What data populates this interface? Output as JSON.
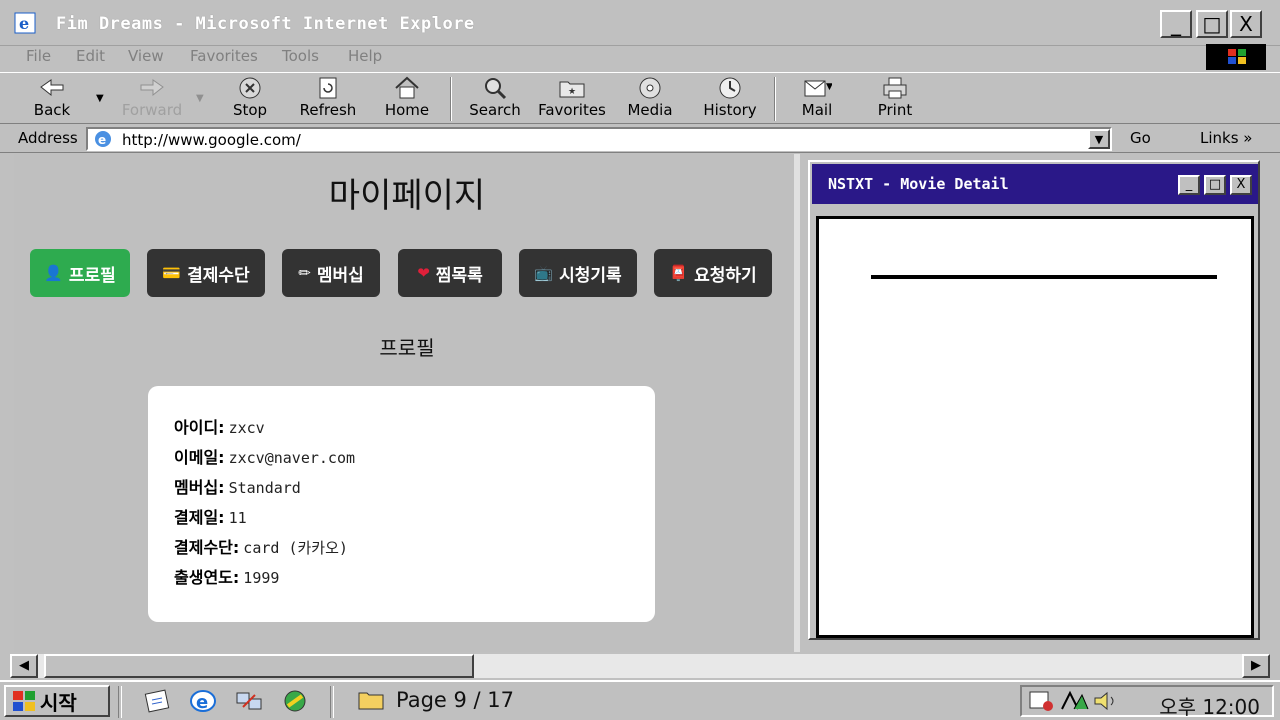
{
  "window": {
    "title": "Fim Dreams - Microsoft Internet Explore"
  },
  "menu": [
    "File",
    "Edit",
    "View",
    "Favorites",
    "Tools",
    "Help"
  ],
  "toolbar": {
    "back": "Back",
    "forward": "Forward",
    "stop": "Stop",
    "refresh": "Refresh",
    "home": "Home",
    "search": "Search",
    "favorites": "Favorites",
    "media": "Media",
    "history": "History",
    "mail": "Mail",
    "print": "Print"
  },
  "address": {
    "label": "Address",
    "url": "http://www.google.com/",
    "go": "Go",
    "links": "Links »"
  },
  "mypage": {
    "title": "마이페이지",
    "nav": [
      {
        "icon": "👤",
        "label": "프로필",
        "active": true
      },
      {
        "icon": "💳",
        "label": "결제수단",
        "active": false
      },
      {
        "icon": "✏",
        "label": "멤버십",
        "active": false
      },
      {
        "icon": "❤",
        "label": "찜목록",
        "active": false
      },
      {
        "icon": "📺",
        "label": "시청기록",
        "active": false
      },
      {
        "icon": "📮",
        "label": "요청하기",
        "active": false
      }
    ],
    "section": "프로필",
    "profile": [
      {
        "key": "아이디",
        "value": "zxcv"
      },
      {
        "key": "이메일",
        "value": "zxcv@naver.com"
      },
      {
        "key": "멤버십",
        "value": "Standard"
      },
      {
        "key": "결제일",
        "value": "11"
      },
      {
        "key": "결제수단",
        "value": "card (카카오)"
      },
      {
        "key": "출생연도",
        "value": "1999"
      }
    ]
  },
  "detail_window": {
    "title": "NSTXT - Movie Detail"
  },
  "taskbar": {
    "start": "시작",
    "task": "Page 9 / 17",
    "clock": "오후 12:00"
  },
  "colors": {
    "active_nav": "#2eab4f",
    "nav": "#333333",
    "detail_titlebar": "#2a1888"
  }
}
